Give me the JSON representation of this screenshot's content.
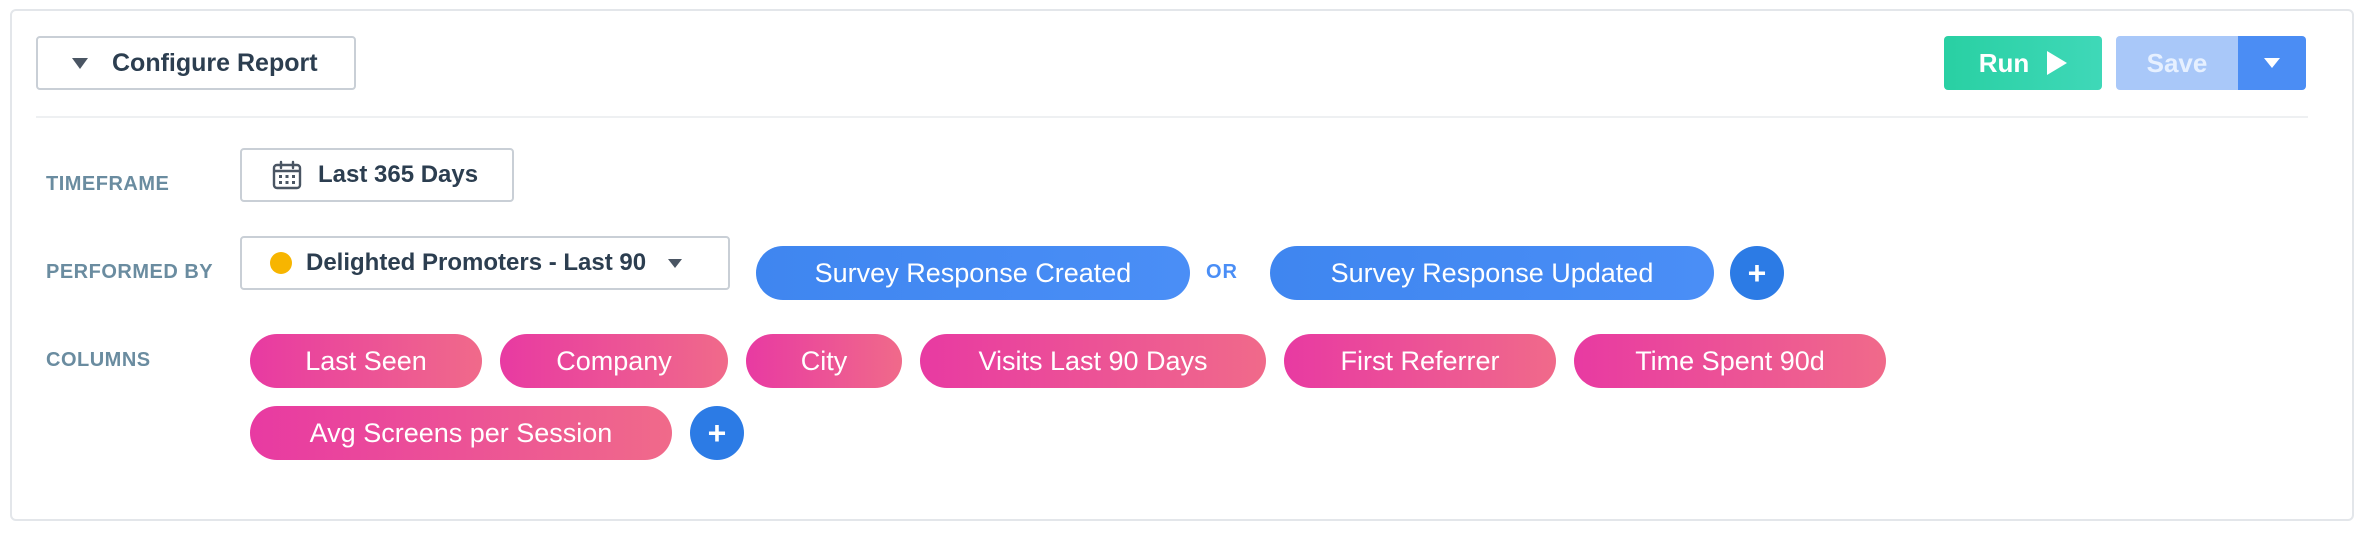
{
  "header": {
    "configure_label": "Configure Report",
    "run_label": "Run",
    "save_label": "Save"
  },
  "timeframe": {
    "label": "TIMEFRAME",
    "value": "Last 365 Days"
  },
  "performed_by": {
    "label": "PERFORMED BY",
    "segment": "Delighted Promoters - Last 90",
    "segment_dot_color": "#f7b500",
    "events": [
      "Survey Response Created",
      "Survey Response Updated"
    ],
    "connector": "OR"
  },
  "columns": {
    "label": "COLUMNS",
    "items": [
      "Last Seen",
      "Company",
      "City",
      "Visits Last 90 Days",
      "First Referrer",
      "Time Spent 90d",
      "Avg Screens per Session"
    ]
  },
  "colors": {
    "run": "#29d0a3",
    "save_disabled": "#a9c8f9",
    "save_dropdown": "#4b8df4",
    "event_pill": "#4a8ef6",
    "column_pill_start": "#e83aa2",
    "column_pill_end": "#f06a8a",
    "add_button": "#2c7be5"
  },
  "icons": {
    "configure": "caret-down-icon",
    "run": "play-icon",
    "save_dropdown": "caret-down-icon",
    "timeframe": "calendar-icon",
    "add": "plus-icon"
  }
}
